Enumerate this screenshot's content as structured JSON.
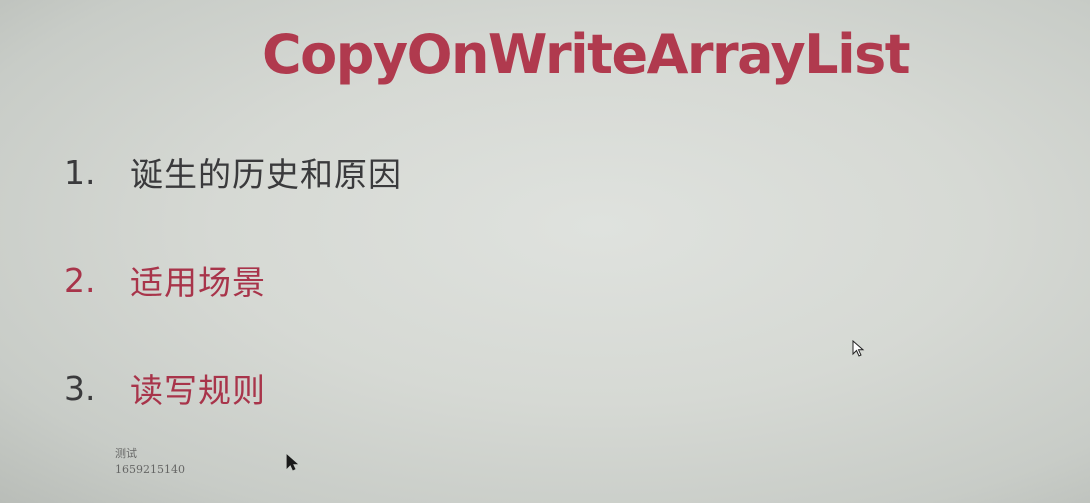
{
  "slide": {
    "title": "CopyOnWriteArrayList",
    "items": [
      {
        "number": "1.",
        "label": "诞生的历史和原因"
      },
      {
        "number": "2.",
        "label": "适用场景"
      },
      {
        "number": "3.",
        "label": "读写规则"
      }
    ],
    "watermark": {
      "line1": "测试",
      "line2": "1659215140"
    }
  },
  "colors": {
    "title": "#b03a4e",
    "item_dark": "#3a3a3c",
    "item_accent": "#a8344a",
    "watermark": "#555555"
  },
  "icons": {
    "cursor_hollow": "mouse-pointer-outline-icon",
    "cursor_solid": "mouse-pointer-solid-icon"
  }
}
